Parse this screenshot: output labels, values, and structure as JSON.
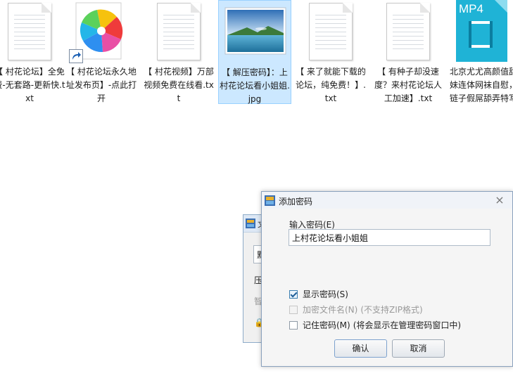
{
  "files": [
    {
      "name": "【 村花论坛】全免费-无套路-更新快.txt",
      "type": "txt",
      "selected": false
    },
    {
      "name": "【 村花论坛永久地址发布页】-点此打开",
      "type": "shortcut",
      "selected": false
    },
    {
      "name": "【 村花视频】万部视频免费在线看.txt",
      "type": "txt",
      "selected": false
    },
    {
      "name": "【 解压密码】：上村花论坛看小姐姐.jpg",
      "type": "jpg",
      "selected": true
    },
    {
      "name": "【 来了就能下载的论坛，纯免费！】.txt",
      "type": "txt",
      "selected": false
    },
    {
      "name": "【 有种子却没速度？来村花论坛人工加速】.txt",
      "type": "txt",
      "selected": false
    },
    {
      "name": "北京尤尤高颜值甜美萌妹连体网袜自慰，项圈链子假屌舔弄特写.",
      "type": "mp4",
      "selected": false
    }
  ],
  "mp4_badge": "MP4",
  "back_dialog": {
    "title": "文",
    "box_text": "默",
    "line1": "压",
    "line2": "智",
    "lock_icon": "lock-icon"
  },
  "dialog": {
    "title": "添加密码",
    "label": "输入密码(E)",
    "password_value": "上村花论坛看小姐姐",
    "show_password": {
      "label": "显示密码(S)",
      "checked": true
    },
    "encrypt_names": {
      "label": "加密文件名(N)",
      "note": "(不支持ZIP格式)",
      "checked": false,
      "disabled": true
    },
    "remember": {
      "label": "记住密码(M)",
      "note": "(将会显示在管理密码窗口中)",
      "checked": false
    },
    "ok_label": "确认",
    "cancel_label": "取消",
    "close_icon": "×"
  },
  "colors": {
    "selection": "#cce8ff",
    "mp4_icon": "#1fb3d6"
  }
}
